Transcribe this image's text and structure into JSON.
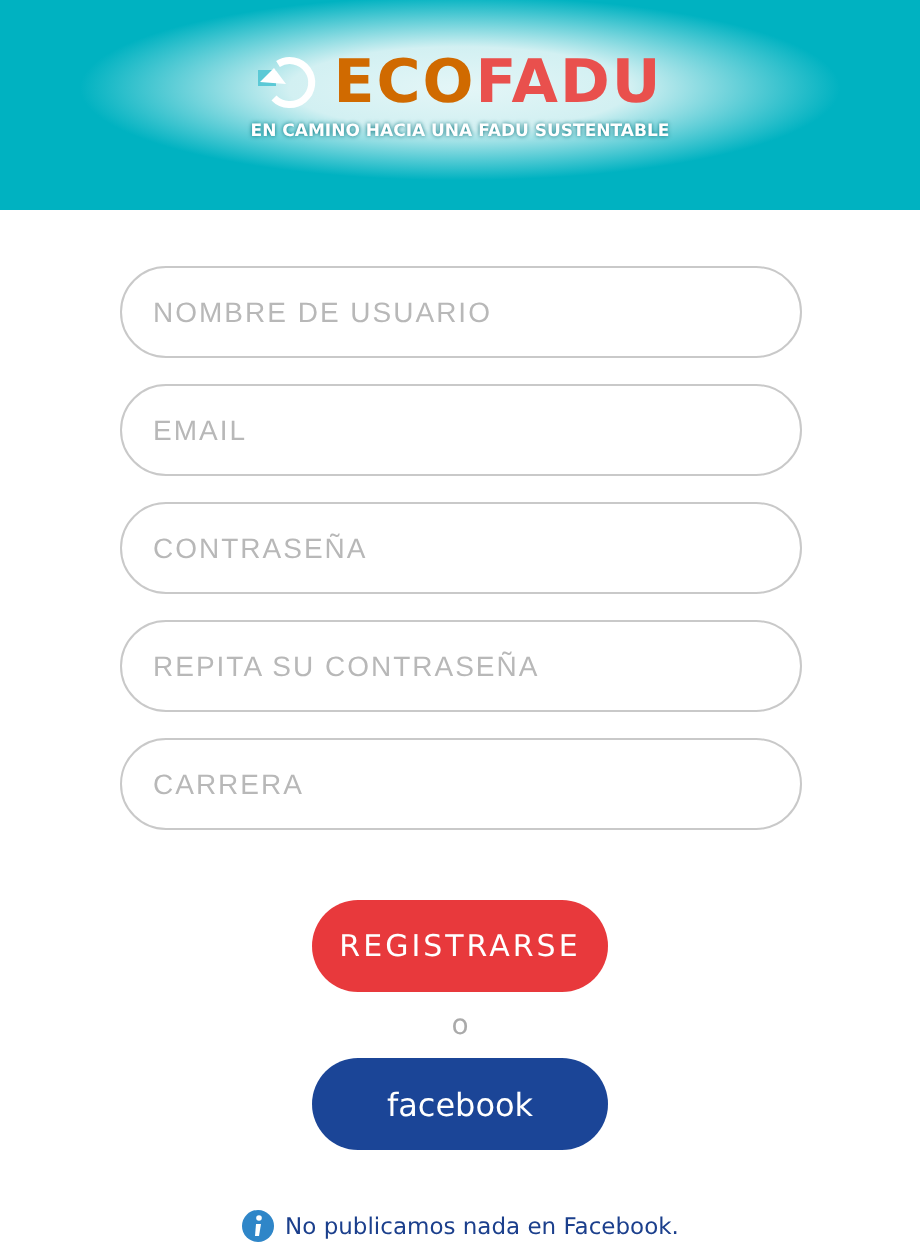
{
  "header": {
    "logo": [
      {
        "text": "ECO",
        "color": "#d06a00"
      },
      {
        "text": "FADU",
        "color": "#e9504d"
      }
    ],
    "tagline": "EN CAMINO HACIA UNA FADU SUSTENTABLE"
  },
  "fields": [
    {
      "placeholder": "NOMBRE DE USUARIO"
    },
    {
      "placeholder": "EMAIL"
    },
    {
      "placeholder": "CONTRASEÑA"
    },
    {
      "placeholder": "REPITA SU CONTRASEÑA"
    },
    {
      "placeholder": "CARRERA"
    }
  ],
  "register_button": "REGISTRARSE",
  "separator": "o",
  "facebook_button": "facebook",
  "notice": "No publicamos nada en Facebook."
}
